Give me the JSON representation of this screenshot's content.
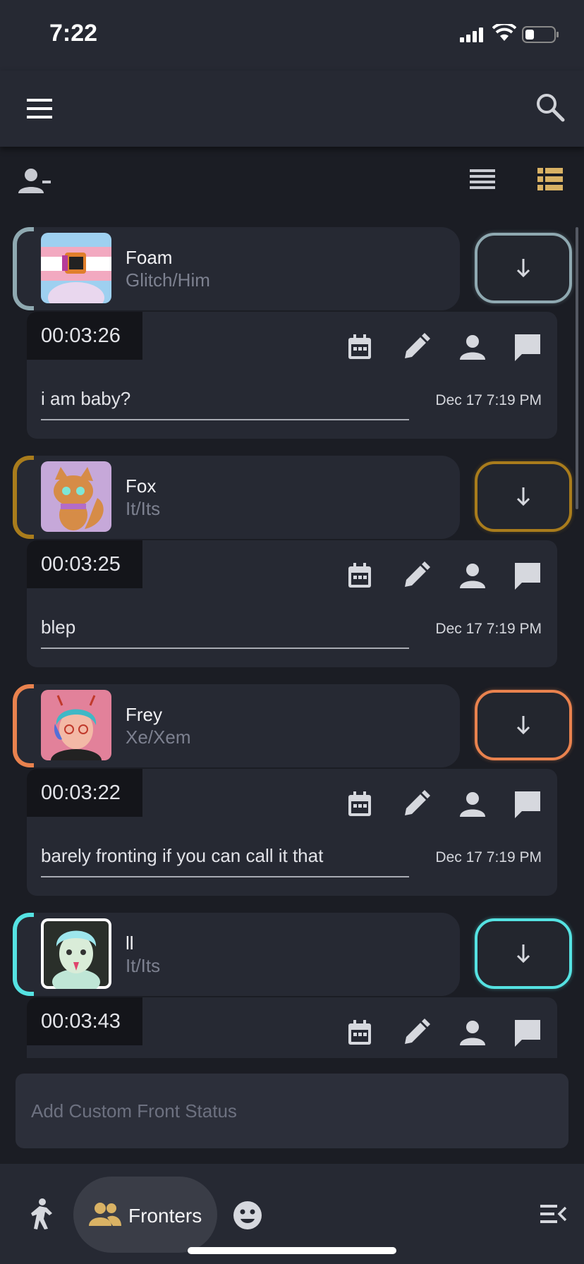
{
  "status_bar": {
    "time": "7:22"
  },
  "app_bar": {
    "menu_icon": "hamburger-menu-icon",
    "search_icon": "search-icon"
  },
  "toolbar": {
    "remove_icon": "person-remove-icon",
    "compact_view_icon": "list-compact-icon",
    "detailed_view_icon": "list-detailed-icon",
    "accent": "#d9b264"
  },
  "members": [
    {
      "name": "Foam",
      "pronouns": "Glitch/Him",
      "color": "#8fa9b1",
      "timer": "00:03:26",
      "note": "i am baby?",
      "date": "Dec 17 7:19 PM"
    },
    {
      "name": "Fox",
      "pronouns": "It/Its",
      "color": "#a97c1c",
      "timer": "00:03:25",
      "note": "blep",
      "date": "Dec 17 7:19 PM"
    },
    {
      "name": "Frey",
      "pronouns": "Xe/Xem",
      "color": "#e9824e",
      "timer": "00:03:22",
      "note": "barely fronting if you can call it that",
      "date": "Dec 17 7:19 PM"
    },
    {
      "name": "ll",
      "pronouns": "It/Its",
      "color": "#55e2e2",
      "timer": "00:03:43",
      "note": "",
      "date": ""
    }
  ],
  "actions": [
    "calendar-icon",
    "edit-pencil-icon",
    "person-icon",
    "comment-icon"
  ],
  "custom_status": {
    "placeholder": "Add Custom Front Status"
  },
  "bottom_nav": {
    "active_label": "Fronters",
    "active_color": "#d9b264"
  }
}
